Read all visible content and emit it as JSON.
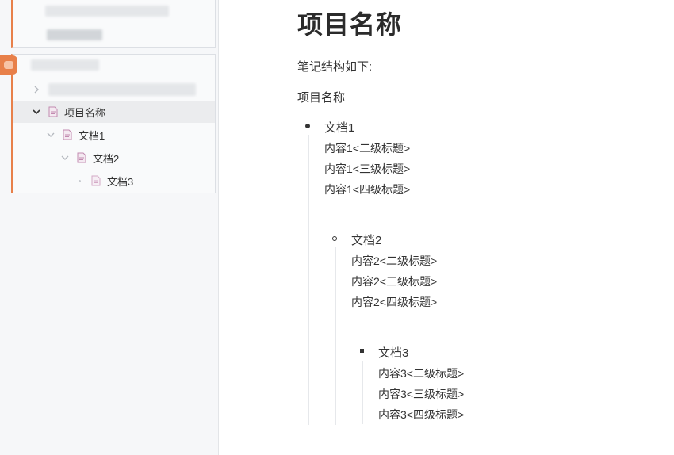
{
  "sidebar": {
    "tree": {
      "root": {
        "label": "项目名称"
      },
      "doc1": {
        "label": "文档1"
      },
      "doc2": {
        "label": "文档2"
      },
      "doc3": {
        "label": "文档3"
      }
    }
  },
  "document": {
    "title": "项目名称",
    "intro": "笔记结构如下:",
    "root_label": "项目名称",
    "items": [
      {
        "label": "文档1",
        "lines": [
          "内容1<二级标题>",
          "内容1<三级标题>",
          "内容1<四级标题>"
        ]
      },
      {
        "label": "文档2",
        "lines": [
          "内容2<二级标题>",
          "内容2<三级标题>",
          "内容2<四级标题>"
        ]
      },
      {
        "label": "文档3",
        "lines": [
          "内容3<二级标题>",
          "内容3<三级标题>",
          "内容3<四级标题>"
        ]
      }
    ]
  },
  "colors": {
    "accent": "#e8804a",
    "doc_icon": "#c28ab0"
  }
}
